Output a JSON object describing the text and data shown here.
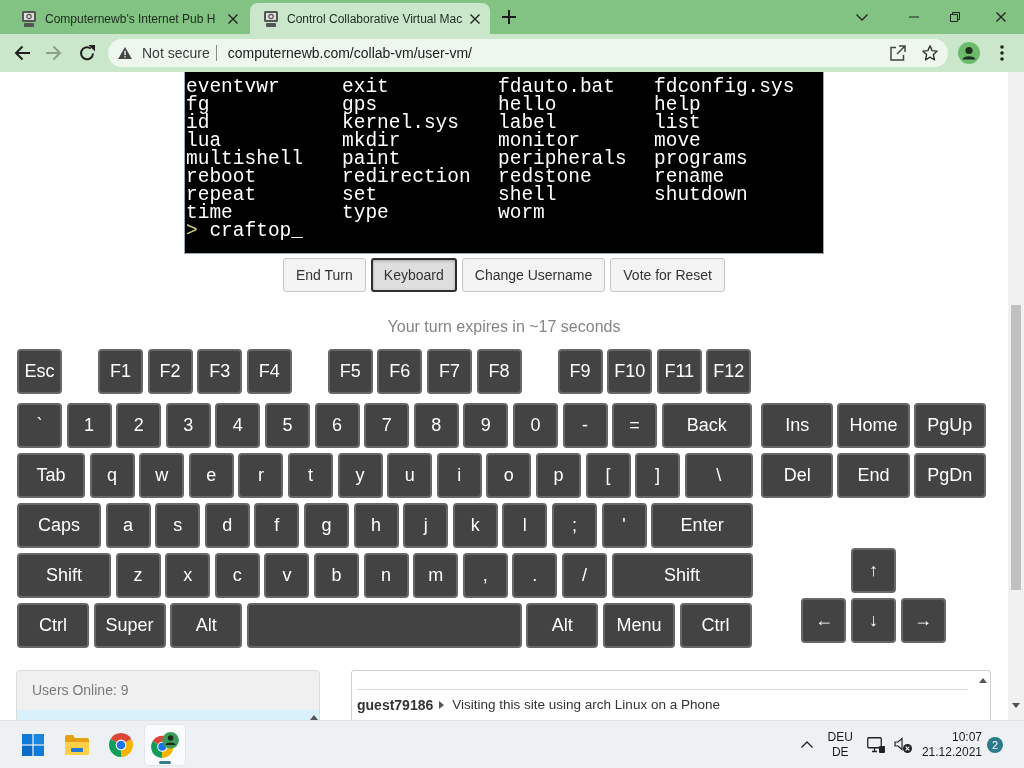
{
  "browser": {
    "tabs": [
      {
        "title": "Computernewb's Internet Pub H",
        "selected": false
      },
      {
        "title": "Control Collaborative Virtual Mac",
        "selected": true
      }
    ],
    "address_bar": {
      "security": "Not secure",
      "url": "computernewb.com/collab-vm/user-vm/"
    }
  },
  "vm_screen": {
    "listing": [
      [
        "eventvwr",
        "exit",
        "fdauto.bat",
        "fdconfig.sys"
      ],
      [
        "fg",
        "gps",
        "hello",
        "help"
      ],
      [
        "id",
        "kernel.sys",
        "label",
        "list"
      ],
      [
        "lua",
        "mkdir",
        "monitor",
        "move"
      ],
      [
        "multishell",
        "paint",
        "peripherals",
        "programs"
      ],
      [
        "reboot",
        "redirection",
        "redstone",
        "rename"
      ],
      [
        "repeat",
        "set",
        "shell",
        "shutdown"
      ],
      [
        "time",
        "type",
        "worm"
      ]
    ],
    "prompt": ">",
    "input": "craftop_"
  },
  "vm_controls": [
    {
      "label": "End Turn",
      "pressed": false
    },
    {
      "label": "Keyboard",
      "pressed": true
    },
    {
      "label": "Change Username",
      "pressed": false
    },
    {
      "label": "Vote for Reset",
      "pressed": false
    }
  ],
  "turn_status": "Your turn expires in ~17 seconds",
  "keyboard": {
    "function_row": [
      [
        "Esc"
      ],
      [
        "F1",
        "F2",
        "F3",
        "F4"
      ],
      [
        "F5",
        "F6",
        "F7",
        "F8"
      ],
      [
        "F9",
        "F10",
        "F11",
        "F12"
      ]
    ],
    "main_rows": [
      [
        "`",
        "1",
        "2",
        "3",
        "4",
        "5",
        "6",
        "7",
        "8",
        "9",
        "0",
        "-",
        "=",
        "Back"
      ],
      [
        "Tab",
        "q",
        "w",
        "e",
        "r",
        "t",
        "y",
        "u",
        "i",
        "o",
        "p",
        "[",
        "]",
        "\\"
      ],
      [
        "Caps",
        "a",
        "s",
        "d",
        "f",
        "g",
        "h",
        "j",
        "k",
        "l",
        ";",
        "'",
        "Enter"
      ],
      [
        "Shift",
        "z",
        "x",
        "c",
        "v",
        "b",
        "n",
        "m",
        ",",
        ".",
        "/",
        "Shift"
      ],
      [
        "Ctrl",
        "Super",
        "Alt",
        null,
        "Alt",
        "Menu",
        "Ctrl"
      ]
    ],
    "nav_keys": [
      [
        "Ins",
        "Home",
        "PgUp"
      ],
      [
        "Del",
        "End",
        "PgDn"
      ]
    ],
    "arrow_keys": [
      [
        "↑"
      ],
      [
        "←",
        "↓",
        "→"
      ]
    ]
  },
  "users_panel": {
    "title": "Users Online: 9"
  },
  "chat": {
    "messages": [
      {
        "user": "guest79186",
        "text": "Visiting this site using arch Linux on a Phone"
      }
    ]
  },
  "taskbar": {
    "apps": [
      {
        "kind": "start",
        "running": false
      },
      {
        "kind": "folder",
        "running": false
      },
      {
        "kind": "browser",
        "running": false
      },
      {
        "kind": "browser-profile",
        "running": true
      }
    ],
    "language": {
      "code": "DEU",
      "layout": "DE"
    },
    "clock": {
      "time": "10:07",
      "date": "21.12.2021"
    },
    "notification_count": "2"
  }
}
